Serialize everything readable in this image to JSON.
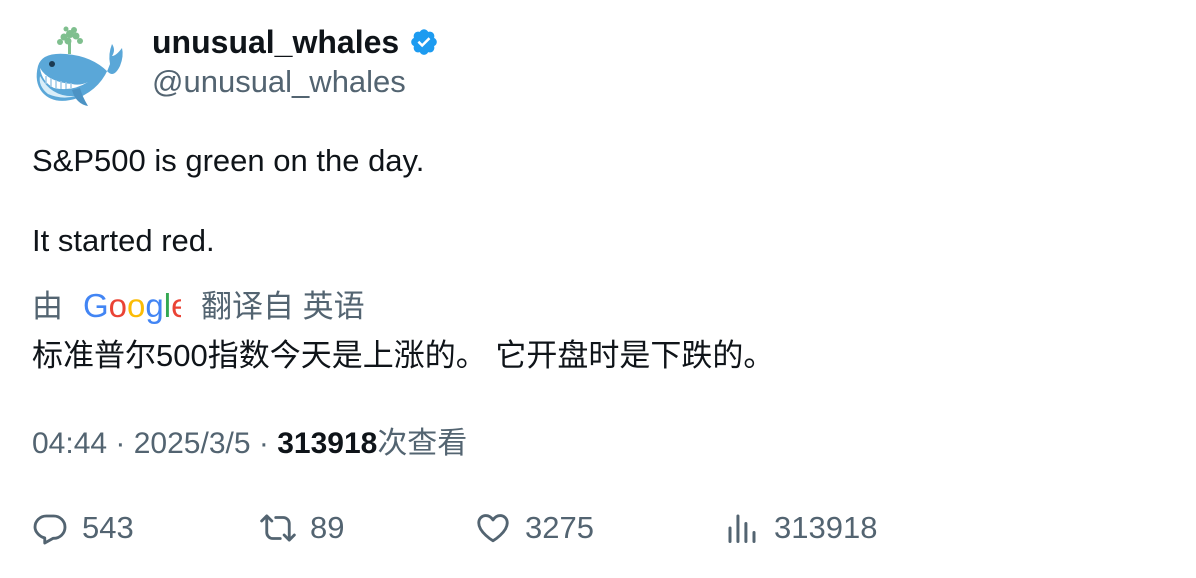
{
  "author": {
    "display_name": "unusual_whales",
    "handle": "@unusual_whales",
    "verified": true,
    "avatar_icon": "whale-icon",
    "verified_icon": "verified-badge-icon"
  },
  "tweet": {
    "line1": "S&P500 is green on the day.",
    "line2": "It started red."
  },
  "translation": {
    "prefix": "由",
    "provider_logo": "Google",
    "suffix": "翻译自 英语",
    "text": "标准普尔500指数今天是上涨的。 它开盘时是下跌的。"
  },
  "meta": {
    "time": "04:44",
    "sep1": " · ",
    "date": "2025/3/5",
    "sep2": " · ",
    "views": "313918",
    "views_suffix": "次查看"
  },
  "actions": {
    "replies": "543",
    "retweets": "89",
    "likes": "3275",
    "views": "313918"
  },
  "colors": {
    "text": "#0f1419",
    "secondary": "#536471",
    "verified": "#1d9bf0"
  }
}
